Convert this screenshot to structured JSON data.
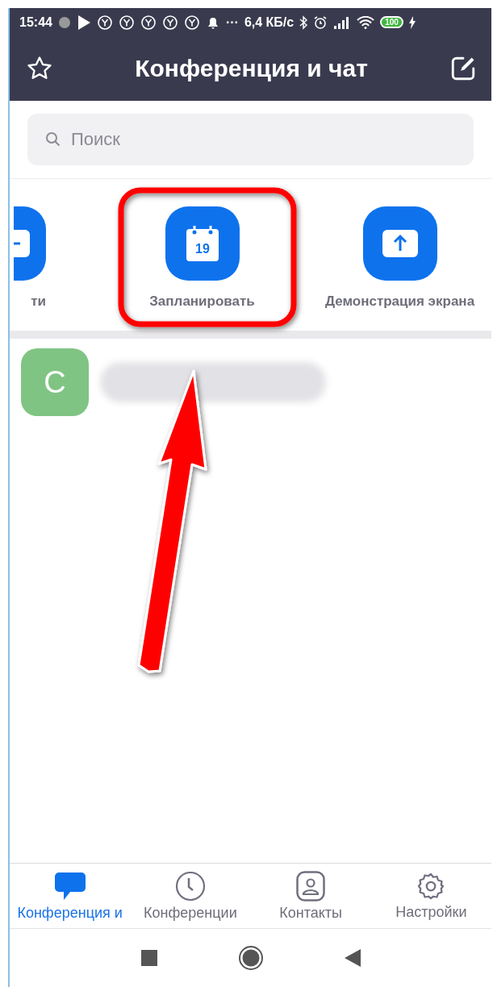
{
  "status_bar": {
    "time": "15:44",
    "more": "···",
    "speed": "6,4 КБ/с",
    "battery": "100"
  },
  "header": {
    "title": "Конференция и чат"
  },
  "search": {
    "placeholder": "Поиск"
  },
  "actions": [
    {
      "label": "ти",
      "kind": "join",
      "clipped": true
    },
    {
      "label": "Запланировать",
      "kind": "schedule",
      "clipped": false,
      "icon_text": "19"
    },
    {
      "label": "Демонстрация экрана",
      "kind": "share",
      "clipped": false
    }
  ],
  "contacts": [
    {
      "initial": "C",
      "color": "#7fc483"
    }
  ],
  "tabs": [
    {
      "label": "Конференция и",
      "kind": "chat",
      "selected": true
    },
    {
      "label": "Конференции",
      "kind": "clock",
      "selected": false
    },
    {
      "label": "Контакты",
      "kind": "contact",
      "selected": false
    },
    {
      "label": "Настройки",
      "kind": "gear",
      "selected": false
    }
  ]
}
